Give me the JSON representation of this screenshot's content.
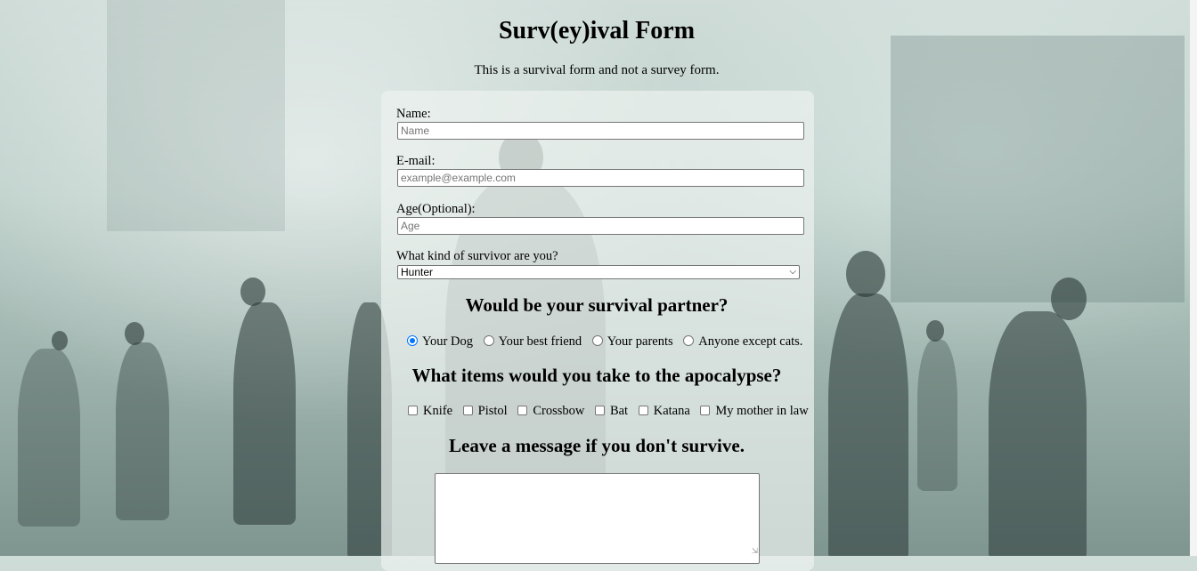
{
  "page": {
    "title": "Surv(ey)ival Form",
    "description": "This is a survival form and not a survey form."
  },
  "form": {
    "name": {
      "label": "Name:",
      "placeholder": "Name"
    },
    "email": {
      "label": "E-mail:",
      "placeholder": "example@example.com"
    },
    "age": {
      "label": "Age(Optional):",
      "placeholder": "Age"
    },
    "survivor_type": {
      "label": "What kind of survivor are you?",
      "selected": "Hunter"
    },
    "partner": {
      "heading": "Would be your survival partner?",
      "options": [
        "Your Dog",
        "Your best friend",
        "Your parents",
        "Anyone except cats."
      ],
      "selected": "Your Dog"
    },
    "items": {
      "heading": "What items would you take to the apocalypse?",
      "options": [
        "Knife",
        "Pistol",
        "Crossbow",
        "Bat",
        "Katana",
        "My mother in law"
      ]
    },
    "message": {
      "heading": "Leave a message if you don't survive."
    }
  },
  "colors": {
    "accent": "#0075ff",
    "panel": "#ebf1ef"
  }
}
